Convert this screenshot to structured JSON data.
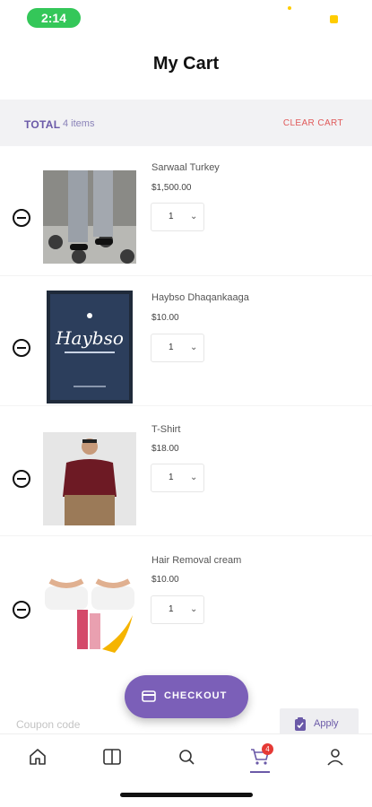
{
  "status_bar": {
    "time": "2:14"
  },
  "header": {
    "title": "My Cart"
  },
  "summary": {
    "total_label": "TOTAL",
    "item_count": "4 items",
    "clear_label": "CLEAR CART"
  },
  "cart": {
    "items": [
      {
        "name": "Sarwaal Turkey",
        "price": "$1,500.00",
        "qty": "1"
      },
      {
        "name": "Haybso Dhaqankaaga",
        "price": "$10.00",
        "qty": "1"
      },
      {
        "name": "T-Shirt",
        "price": "$18.00",
        "qty": "1"
      },
      {
        "name": "Hair Removal cream",
        "price": "$10.00",
        "qty": "1"
      }
    ]
  },
  "book_cover_text": "Haybso",
  "checkout": {
    "label": "CHECKOUT"
  },
  "coupon": {
    "placeholder": "Coupon code",
    "apply_label": "Apply"
  },
  "tabbar": {
    "tabs": [
      {
        "icon": "home-icon"
      },
      {
        "icon": "book-icon"
      },
      {
        "icon": "search-icon"
      },
      {
        "icon": "cart-icon",
        "badge": "4",
        "active": true
      },
      {
        "icon": "profile-icon"
      }
    ]
  },
  "colors": {
    "accent": "#7b5fb8",
    "clear": "#e05a5a",
    "status_green": "#34c759",
    "badge": "#e53935"
  }
}
